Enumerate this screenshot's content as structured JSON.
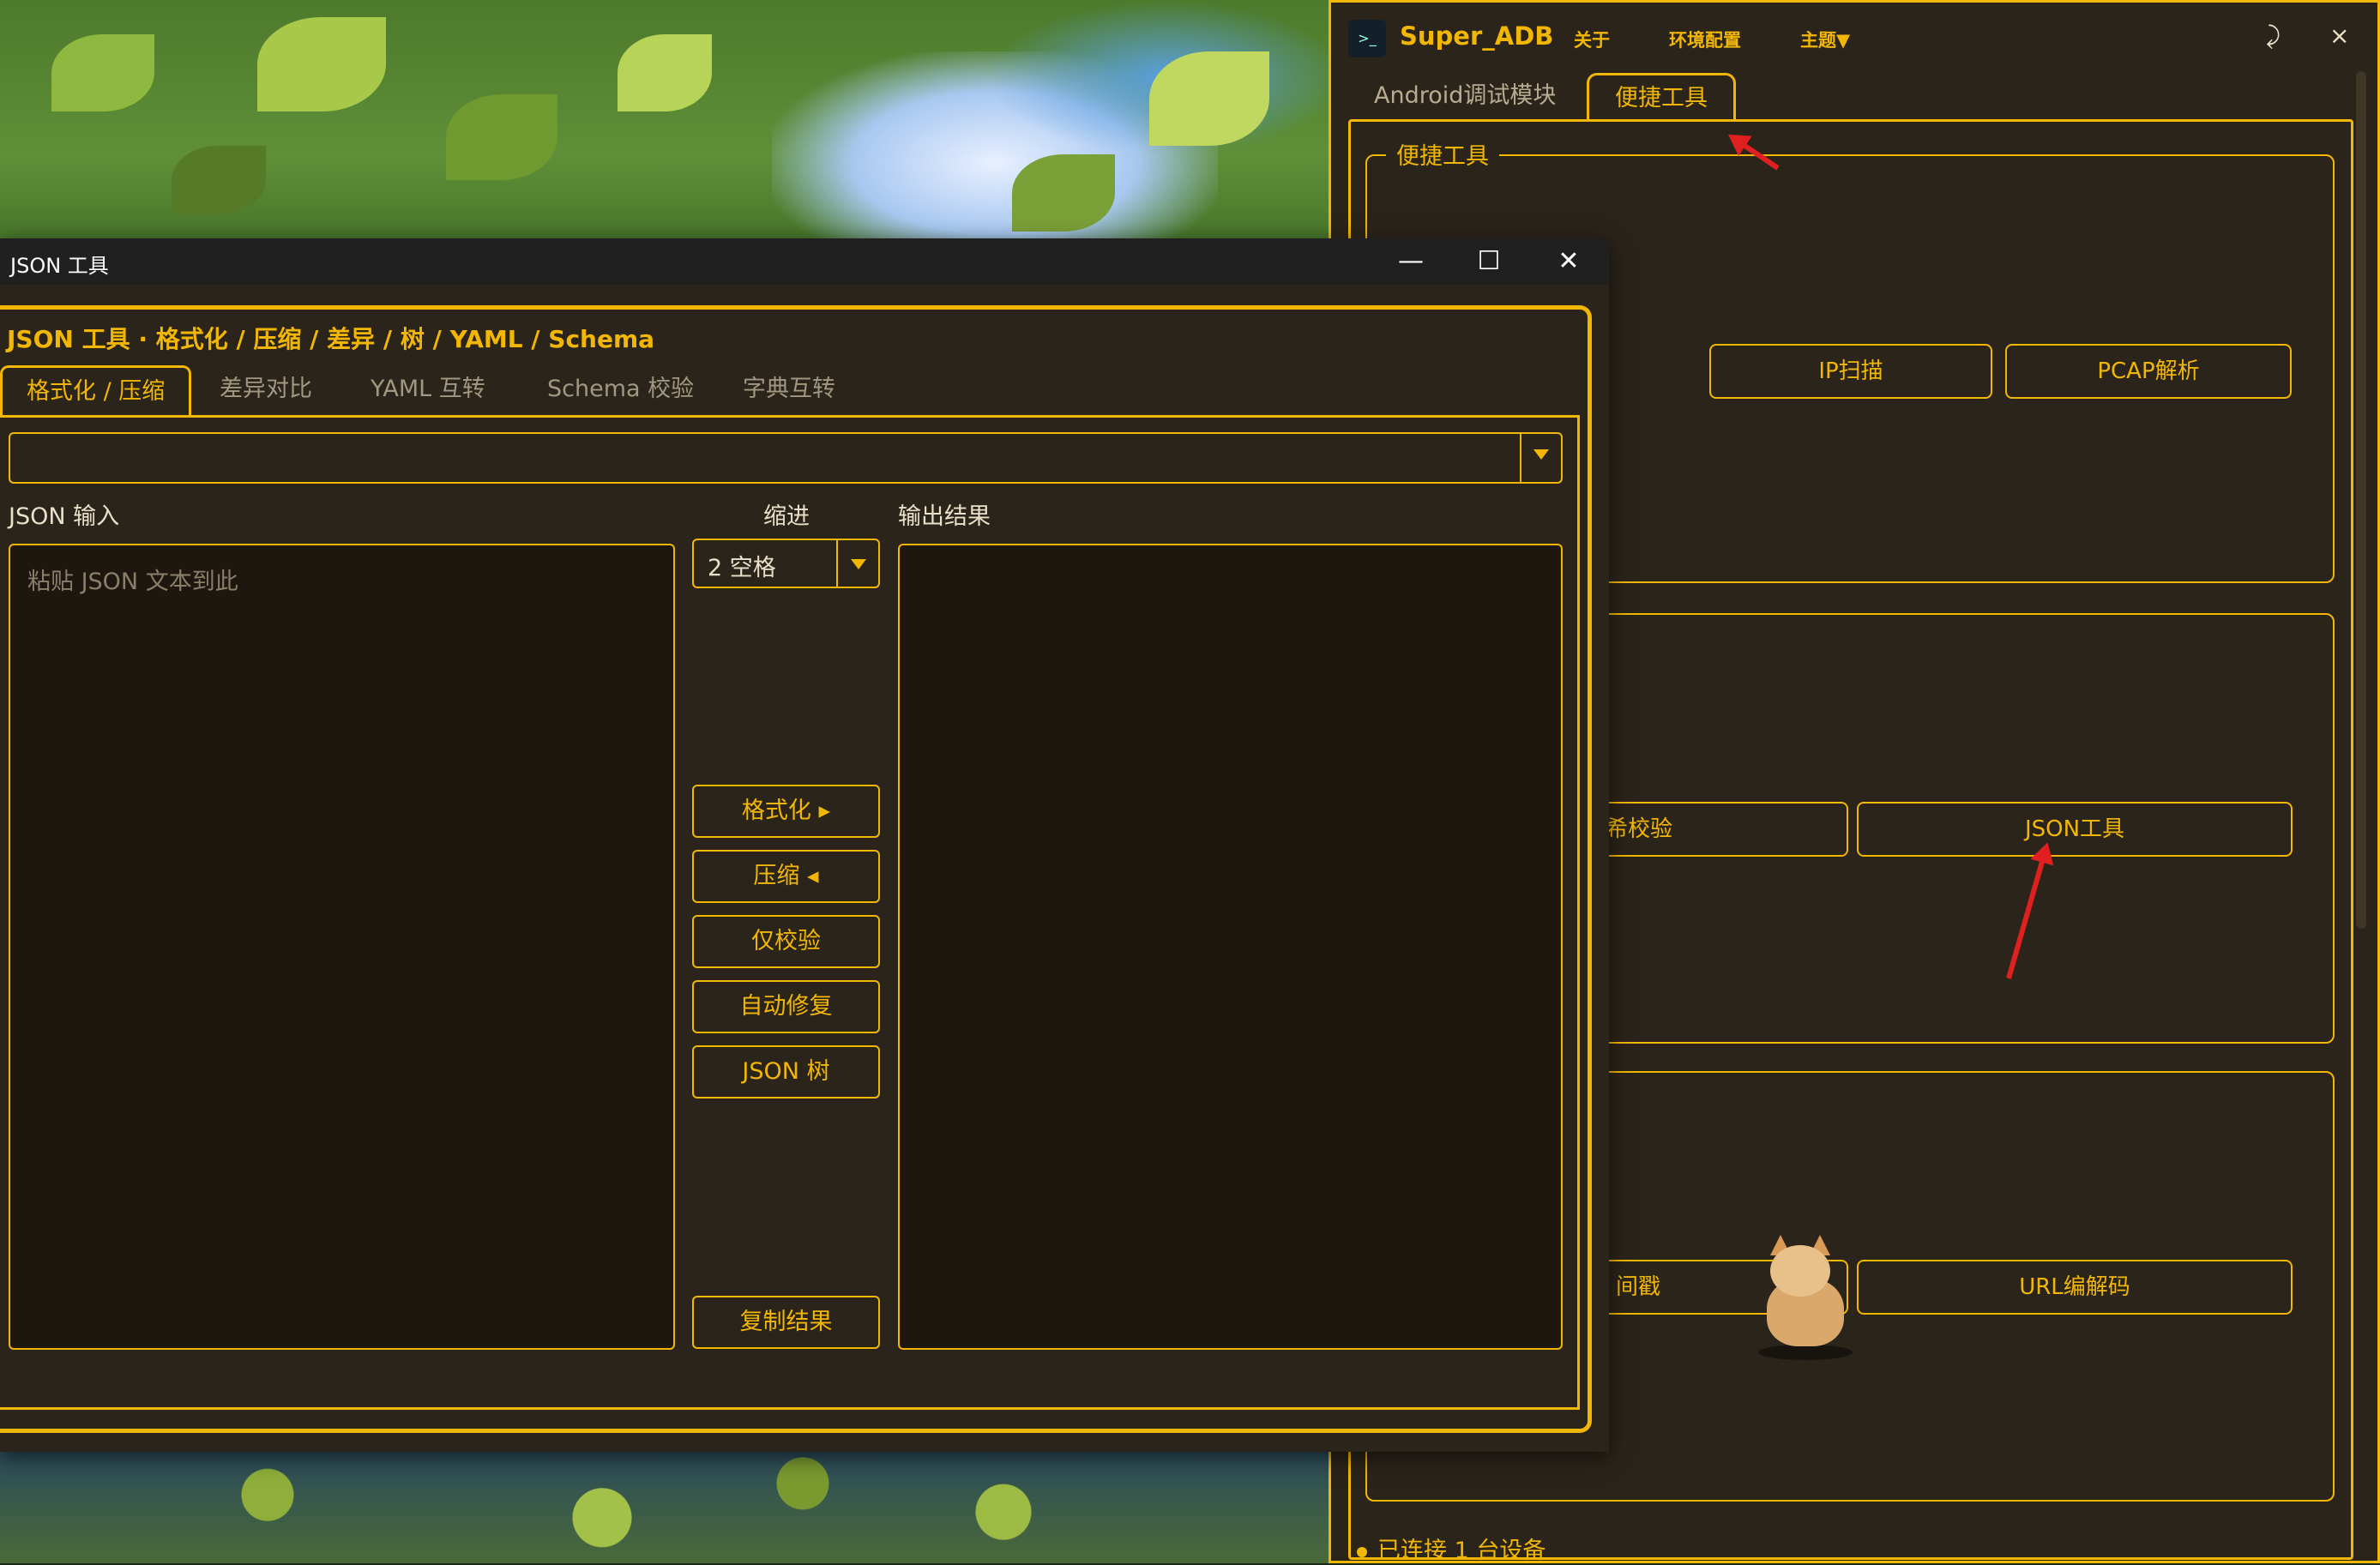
{
  "super_adb": {
    "app_name": "Super_ADB",
    "menu": {
      "about": "关于",
      "env_config": "环境配置",
      "theme": "主题▼"
    },
    "controls": {
      "pin": "⤸",
      "close": "×"
    },
    "tabs": [
      {
        "label": "Android调试模块",
        "active": false
      },
      {
        "label": "便捷工具",
        "active": true
      }
    ],
    "group_title": "便捷工具",
    "tool_buttons": {
      "ip_scan": "IP扫描",
      "pcap_parse": "PCAP解析",
      "hash_check_partial": "希校验",
      "json_tool": "JSON工具",
      "timestamp_partial": "间戳",
      "url_codec": "URL编解码"
    },
    "status": "已连接 1 台设备"
  },
  "json_window": {
    "title": "JSON 工具",
    "controls": {
      "minimize": "—",
      "maximize": "☐",
      "close": "✕"
    },
    "heading": "JSON 工具 · 格式化 / 压缩 / 差异 / 树 / YAML / Schema",
    "tabs": [
      {
        "label": "格式化 / 压缩",
        "active": true
      },
      {
        "label": "差异对比",
        "active": false
      },
      {
        "label": "YAML 互转",
        "active": false
      },
      {
        "label": "Schema 校验",
        "active": false
      },
      {
        "label": "字典互转",
        "active": false
      }
    ],
    "input_label": "JSON 输入",
    "input_placeholder": "粘贴 JSON 文本到此",
    "indent_label": "缩进",
    "indent_value": "2 空格",
    "output_label": "输出结果",
    "actions": {
      "format": "格式化 ▸",
      "compress": "压缩 ◂",
      "validate": "仅校验",
      "auto_fix": "自动修复",
      "json_tree": "JSON 树",
      "copy_result": "复制结果"
    }
  },
  "colors": {
    "accent": "#f2b705",
    "window_bg": "#2b241a",
    "textarea_bg": "#1e1710",
    "annotation_arrow": "#e02020"
  }
}
